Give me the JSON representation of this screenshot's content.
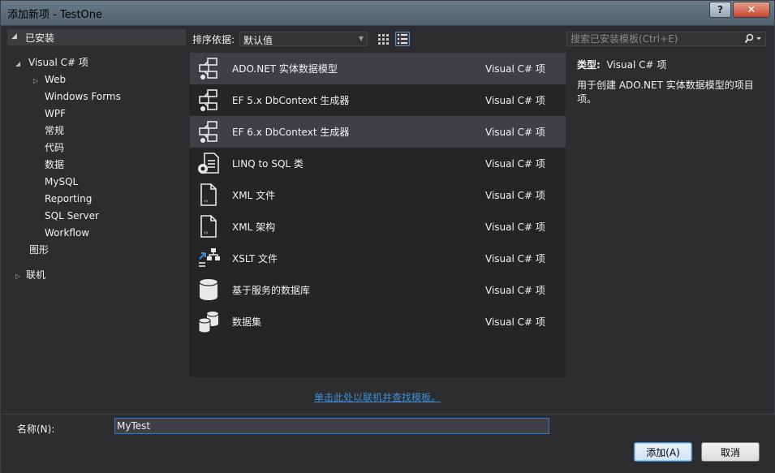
{
  "window": {
    "title": "添加新项 - TestOne",
    "help_label": "?",
    "close_label": "✕"
  },
  "sidebar": {
    "installed_label": "已安装",
    "items": [
      {
        "label": "Visual C# 项",
        "arrow": "◢"
      },
      {
        "label": "Web",
        "arrow": "▷"
      },
      {
        "label": "Windows Forms",
        "arrow": ""
      },
      {
        "label": "WPF",
        "arrow": ""
      },
      {
        "label": "常规",
        "arrow": ""
      },
      {
        "label": "代码",
        "arrow": ""
      },
      {
        "label": "数据",
        "arrow": ""
      },
      {
        "label": "MySQL",
        "arrow": ""
      },
      {
        "label": "Reporting",
        "arrow": ""
      },
      {
        "label": "SQL Server",
        "arrow": ""
      },
      {
        "label": "Workflow",
        "arrow": ""
      },
      {
        "label": "图形",
        "arrow": ""
      },
      {
        "label": "联机",
        "arrow": "▷"
      }
    ]
  },
  "toolbar": {
    "sort_label": "排序依据:",
    "sort_value": "默认值"
  },
  "search": {
    "placeholder": "搜索已安装模板(Ctrl+E)"
  },
  "templates": [
    {
      "name": "ADO.NET 实体数据模型",
      "category": "Visual C# 项",
      "icon": "entity-model-icon"
    },
    {
      "name": "EF 5.x DbContext 生成器",
      "category": "Visual C# 项",
      "icon": "entity-model-icon"
    },
    {
      "name": "EF 6.x DbContext 生成器",
      "category": "Visual C# 项",
      "icon": "entity-model-icon"
    },
    {
      "name": "LINQ to SQL 类",
      "category": "Visual C# 项",
      "icon": "linq-to-sql-icon"
    },
    {
      "name": "XML 文件",
      "category": "Visual C# 项",
      "icon": "xml-file-icon"
    },
    {
      "name": "XML 架构",
      "category": "Visual C# 项",
      "icon": "xml-schema-icon"
    },
    {
      "name": "XSLT 文件",
      "category": "Visual C# 项",
      "icon": "xslt-file-icon"
    },
    {
      "name": "基于服务的数据库",
      "category": "Visual C# 项",
      "icon": "database-icon"
    },
    {
      "name": "数据集",
      "category": "Visual C# 项",
      "icon": "dataset-icon"
    }
  ],
  "detail": {
    "type_key": "类型:",
    "type_value": "Visual C# 项",
    "description": "用于创建 ADO.NET 实体数据模型的项目项。"
  },
  "online_link": "单击此处以联机并查找模板。",
  "bottom": {
    "name_label": "名称(N):",
    "name_value": "MyTest",
    "add_label": "添加(A)",
    "cancel_label": "取消"
  }
}
